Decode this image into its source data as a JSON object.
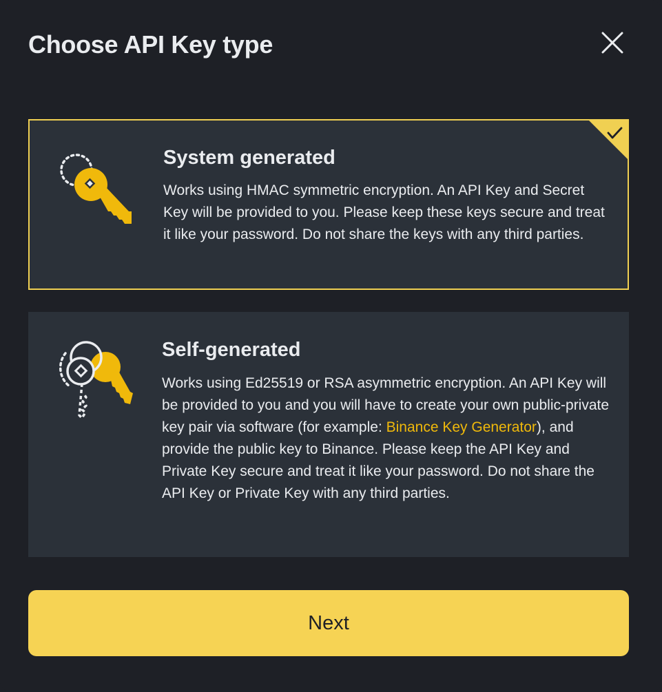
{
  "dialog": {
    "title": "Choose API Key type",
    "close_icon": "close-icon"
  },
  "options": [
    {
      "heading": "System generated",
      "description": "Works using HMAC symmetric encryption. An API Key and Secret Key will be provided to you. Please keep these keys secure and treat it like your password. Do not share the keys with any third parties.",
      "icon": "key-icon",
      "selected": true
    },
    {
      "heading": "Self-generated",
      "description_before_link": "Works using Ed25519 or RSA asymmetric encryption. An API Key will be provided to you and you will have to create your own public-private key pair via software (for example: ",
      "link_text": "Binance Key Generator",
      "description_after_link": "), and provide the public key to Binance. Please keep the API Key and Private Key secure and treat it like your password. Do not share the API Key or Private Key with any third parties.",
      "icon": "key-pair-icon",
      "selected": false
    }
  ],
  "next_label": "Next",
  "colors": {
    "background": "#1e2026",
    "card": "#2b3139",
    "accent": "#f0d052",
    "link": "#f0b90b",
    "button": "#f6d354",
    "text": "#eaecef"
  }
}
